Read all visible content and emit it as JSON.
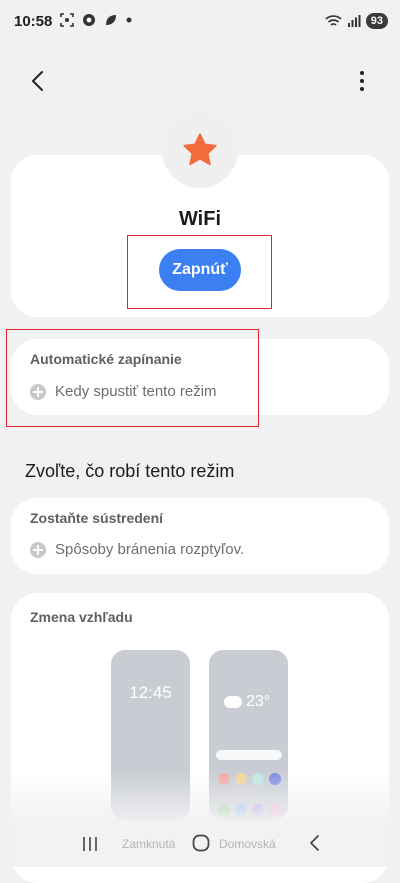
{
  "status_bar": {
    "time": "10:58",
    "battery": "93",
    "icons": [
      "screenshot-icon",
      "chrome-icon",
      "leaf-icon",
      "dot-icon",
      "wifi-icon",
      "signal-icon"
    ]
  },
  "top_bar": {
    "back_icon": "chevron-left-icon",
    "more_icon": "more-vertical-icon"
  },
  "mode": {
    "icon": "star-icon",
    "icon_color": "#f26b3a",
    "title": "WiFi",
    "turn_on_label": "Zapnúť",
    "button_color": "#3b7ff3"
  },
  "auto_on": {
    "label": "Automatické zapínanie",
    "action": "Kedy spustiť tento režim"
  },
  "what_it_does": {
    "heading": "Zvoľte, čo robí tento režim"
  },
  "focus": {
    "label": "Zostaňte sústredení",
    "action": "Spôsoby bránenia rozptyľov."
  },
  "appearance": {
    "label": "Zmena vzhľadu",
    "lock_preview_time": "12:45",
    "home_preview_temp": "23°",
    "lock_caption": "Zamknutá",
    "home_caption": "Domovská"
  },
  "highlight_color": "#e0232b"
}
